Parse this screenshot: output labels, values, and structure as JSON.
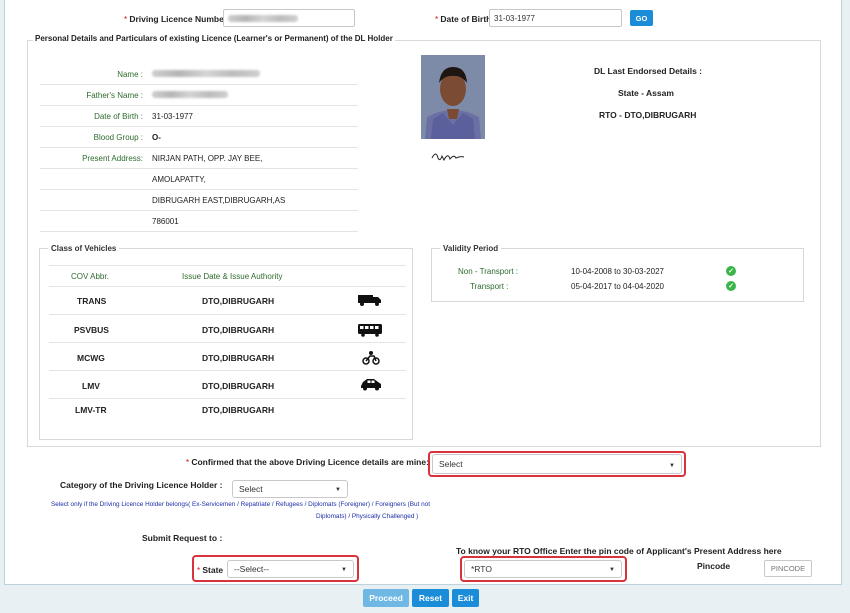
{
  "header": {
    "dl_label": "Driving Licence Number",
    "dob_label": "Date of Birth",
    "dob_value": "31-03-1977",
    "go_label": "GO"
  },
  "details_title": "Personal Details and Particulars of existing Licence (Learner's or Permanent) of the DL Holder",
  "person": {
    "name_label": "Name :",
    "father_label": "Father's Name :",
    "dob_label": "Date of Birth :",
    "dob_value": "31-03-1977",
    "blood_label": "Blood Group :",
    "blood_value": "O-",
    "address_label": "Present Address:",
    "address_lines": [
      "NIRJAN PATH, OPP. JAY BEE,",
      "AMOLAPATTY,",
      "DIBRUGARH EAST,DIBRUGARH,AS",
      "786001"
    ]
  },
  "endorsed": {
    "title": "DL Last Endorsed Details :",
    "state": "State - Assam",
    "rto": "RTO - DTO,DIBRUGARH"
  },
  "vehicles": {
    "legend": "Class of Vehicles",
    "col1": "COV Abbr.",
    "col2": "Issue Date & Issue Authority",
    "rows": [
      {
        "cov": "TRANS",
        "auth": "DTO,DIBRUGARH",
        "icon": "truck-icon"
      },
      {
        "cov": "PSVBUS",
        "auth": "DTO,DIBRUGARH",
        "icon": "bus-icon"
      },
      {
        "cov": "MCWG",
        "auth": "DTO,DIBRUGARH",
        "icon": "motorcycle-icon"
      },
      {
        "cov": "LMV",
        "auth": "DTO,DIBRUGARH",
        "icon": "car-icon"
      },
      {
        "cov": "LMV-TR",
        "auth": "DTO,DIBRUGARH",
        "icon": ""
      }
    ]
  },
  "validity": {
    "legend": "Validity Period",
    "rows": [
      {
        "label": "Non - Transport :",
        "range": "10-04-2008 to 30-03-2027"
      },
      {
        "label": "Transport :",
        "range": "05-04-2017 to 04-04-2020"
      }
    ]
  },
  "confirm": {
    "label": "Confirmed that the above Driving Licence details are mine:",
    "value": "Select"
  },
  "category": {
    "label": "Category of the Driving Licence Holder :",
    "value": "Select",
    "note_line1": "Select only if the Driving Licence Holder belongs( Ex-Servicemen / Repatriate / Refugees / Diplomats (Foreigner) / Foreigners (But not",
    "note_line2": "Diplomats) / Physically Challenged )"
  },
  "submit": {
    "label": "Submit Request to :",
    "state_label": "State",
    "state_value": "--Select--",
    "rto_hint": "To know your RTO Office Enter the pin code of Applicant's Present Address here",
    "rto_value": "*RTO",
    "pincode_label": "Pincode",
    "pincode_placeholder": "PINCODE"
  },
  "buttons": {
    "proceed": "Proceed",
    "reset": "Reset",
    "exit": "Exit"
  },
  "colors": {
    "accent": "#1a8cd8",
    "highlight": "#d8323c",
    "label_green": "#2e6b2e"
  }
}
